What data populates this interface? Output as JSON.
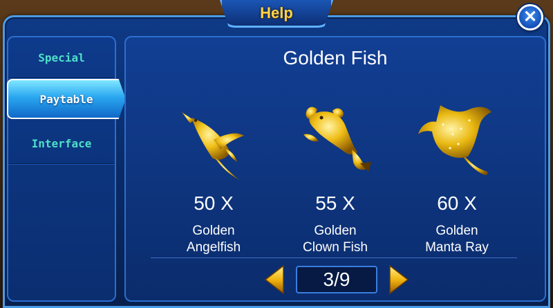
{
  "header": {
    "title": "Help"
  },
  "close": {
    "glyph": "✕"
  },
  "sidebar": {
    "items": [
      {
        "label": "Special",
        "active": false
      },
      {
        "label": "Paytable",
        "active": true
      },
      {
        "label": "Interface",
        "active": false
      }
    ]
  },
  "content": {
    "title": "Golden Fish",
    "fish": [
      {
        "multiplier": "50 X",
        "name_line1": "Golden",
        "name_line2": "Angelfish",
        "icon": "golden-angelfish-icon"
      },
      {
        "multiplier": "55 X",
        "name_line1": "Golden",
        "name_line2": "Clown Fish",
        "icon": "golden-clown-fish-icon"
      },
      {
        "multiplier": "60 X",
        "name_line1": "Golden",
        "name_line2": "Manta Ray",
        "icon": "golden-manta-ray-icon"
      }
    ]
  },
  "pager": {
    "label": "3/9",
    "current": 3,
    "total": 9
  },
  "colors": {
    "gold": "#ffd34a",
    "tab_text": "#4ee0c8",
    "panel": "#0b2c6c"
  }
}
